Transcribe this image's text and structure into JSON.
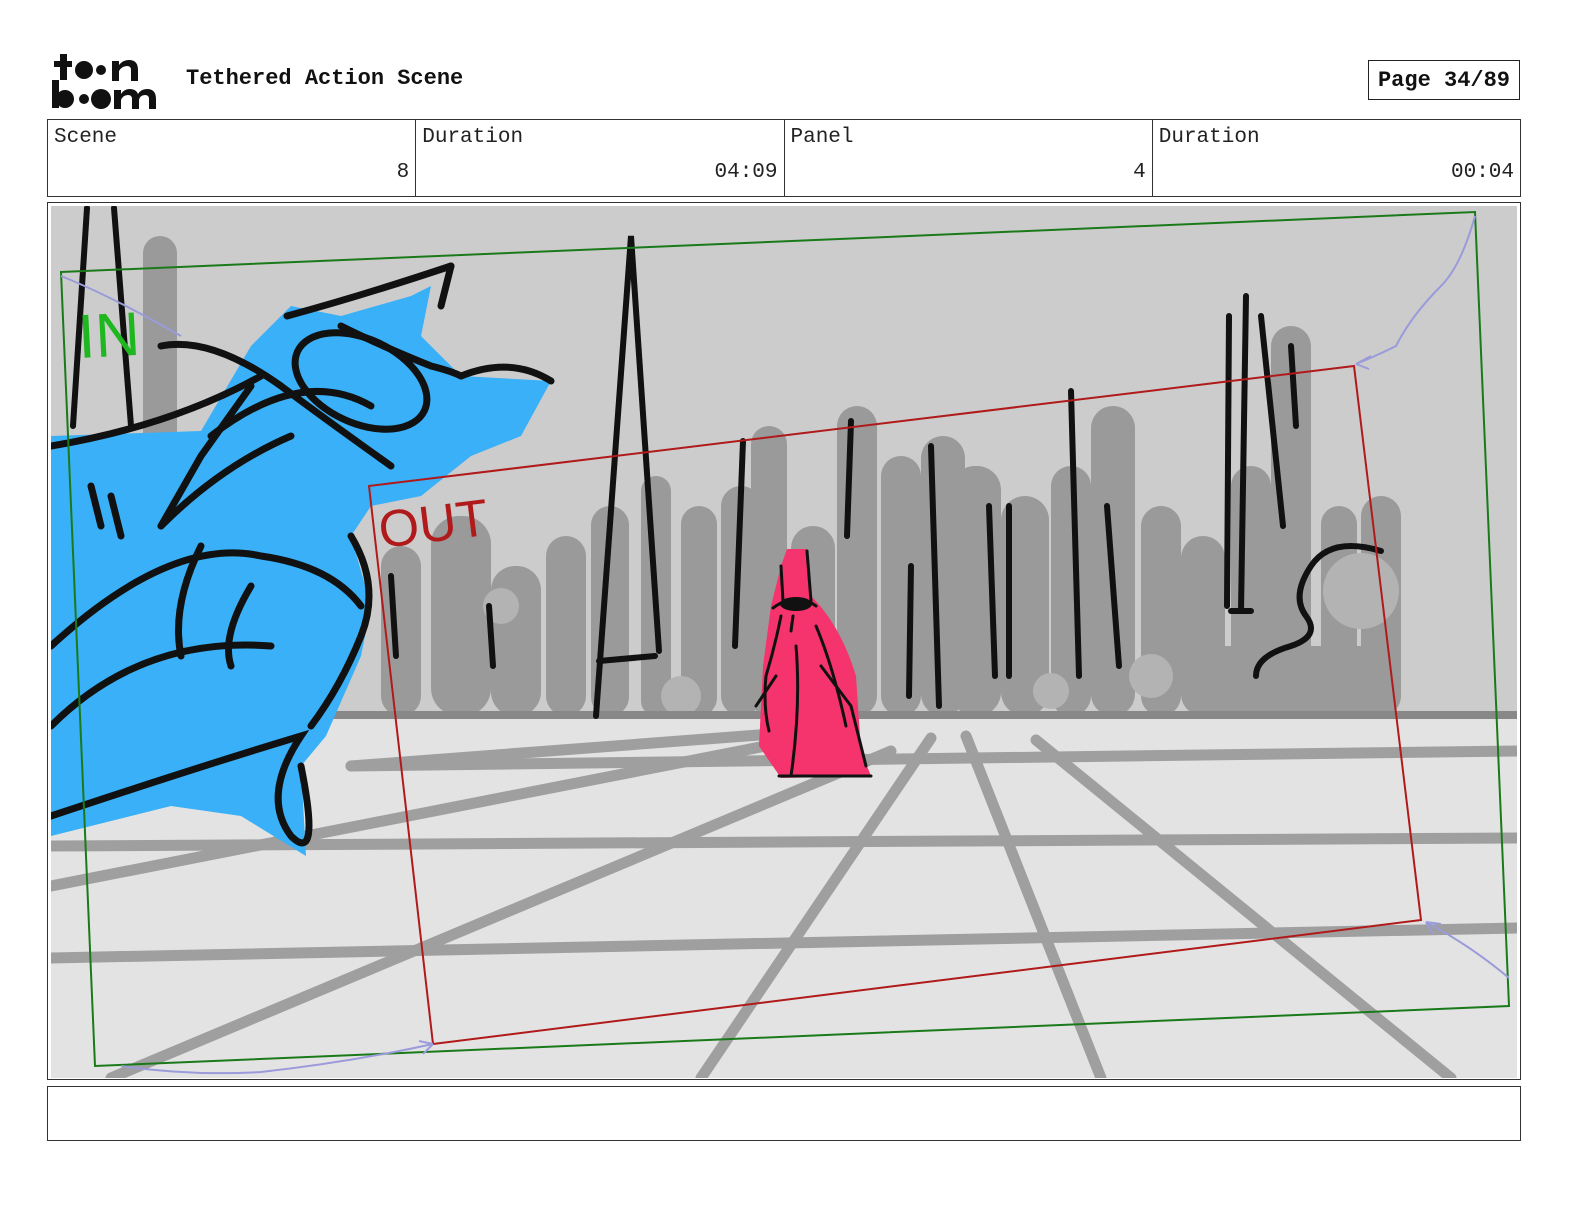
{
  "header": {
    "logo_text": "toonboom",
    "title": "Tethered Action Scene",
    "page_label": "Page 34/89"
  },
  "info": [
    {
      "label": "Scene",
      "value": "8"
    },
    {
      "label": "Duration",
      "value": "04:09"
    },
    {
      "label": "Panel",
      "value": "4"
    },
    {
      "label": "Duration",
      "value": "00:04"
    }
  ],
  "panel": {
    "in_label": "IN",
    "out_label": "OUT",
    "colors": {
      "sky": "#cccccc",
      "floor": "#e3e3e3",
      "buildings": "#9a9a9a",
      "hand": "#39b0f7",
      "figure": "#f5336d",
      "in_frame": "#1a7a1a",
      "out_frame": "#b01a1a",
      "camera_path": "#9b9bdb"
    }
  },
  "notes": ""
}
